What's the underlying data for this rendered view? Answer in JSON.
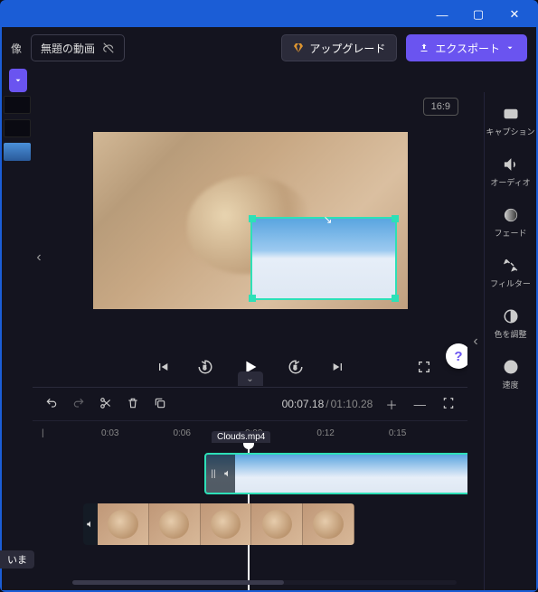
{
  "header": {
    "project_title": "無題の動画",
    "upgrade_label": "アップグレード",
    "export_label": "エクスポート",
    "aspect_label": "16:9"
  },
  "side_panel": {
    "captions": "キャプション",
    "audio": "オーディオ",
    "fade": "フェード",
    "filter": "フィルター",
    "color": "色を調整",
    "speed": "速度"
  },
  "timeline": {
    "current_time": "00:07.18",
    "total_time": "01:10.28",
    "ruler": [
      "0:03",
      "0:06",
      "0:09",
      "0:12",
      "0:15"
    ],
    "overlay_clip_name": "Clouds.mp4"
  },
  "misc": {
    "bottom_label": "いま",
    "left_tab_char": "像",
    "help_char": "?"
  }
}
